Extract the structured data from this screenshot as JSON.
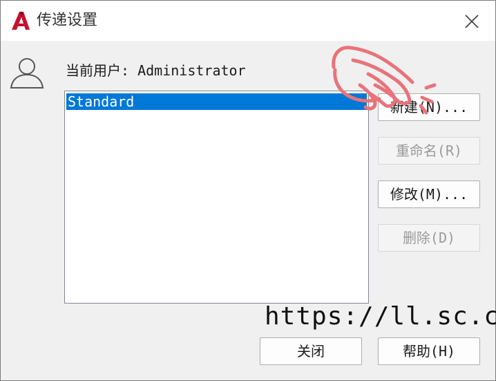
{
  "window": {
    "title": "传递设置",
    "app_icon_letter": "A"
  },
  "user": {
    "label": "当前用户: Administrator"
  },
  "list": {
    "items": [
      "Standard"
    ],
    "selected_index": 0
  },
  "buttons": {
    "new": "新建(N)...",
    "rename": "重命名(R)",
    "modify": "修改(M)...",
    "delete": "删除(D)",
    "close": "关闭",
    "help": "帮助(H)"
  },
  "overlay": {
    "watermark": "https://ll.sc.cn"
  },
  "colors": {
    "selection": "#0078d7",
    "app_icon": "#c8102e",
    "hand_pointer": "#e8737a"
  },
  "icons": {
    "app": "autocad-logo-icon",
    "close": "close-icon",
    "user": "user-icon",
    "pointer": "hand-pointer-icon"
  }
}
